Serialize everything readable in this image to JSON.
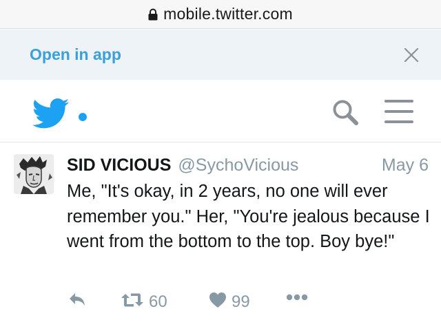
{
  "browser": {
    "url": "mobile.twitter.com",
    "lock_icon": "lock-icon"
  },
  "banner": {
    "open_label": "Open in app",
    "close_icon": "close-icon",
    "accent": "#3a9fdd"
  },
  "nav": {
    "logo_icon": "twitter-bird-icon",
    "search_icon": "search-icon",
    "menu_icon": "hamburger-menu-icon"
  },
  "tweet": {
    "author_name": "SID VICIOUS",
    "author_handle": "@SychoVicious",
    "date": "May 6",
    "text": "Me, \"It's okay, in 2 years, no one will ever remember you.\" Her, \"You're jealous because I went from the bottom to the top. Boy bye!\"",
    "retweet_count": "60",
    "like_count": "99"
  },
  "colors": {
    "twitter_blue": "#1da1f2",
    "muted_gray": "#8899a6",
    "text": "#14171a"
  }
}
